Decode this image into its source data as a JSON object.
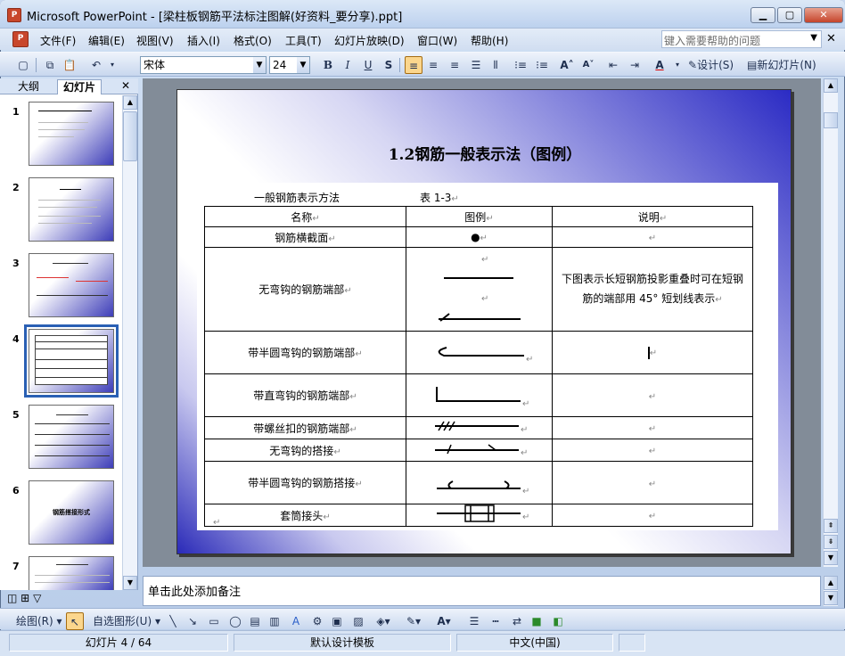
{
  "window": {
    "title": "Microsoft PowerPoint - [梁柱板钢筋平法标注图解(好资料_要分享).ppt]"
  },
  "menu": [
    "文件(F)",
    "编辑(E)",
    "视图(V)",
    "插入(I)",
    "格式(O)",
    "工具(T)",
    "幻灯片放映(D)",
    "窗口(W)",
    "帮助(H)"
  ],
  "help": {
    "placeholder": "键入需要帮助的问题"
  },
  "toolbar": {
    "font": "宋体",
    "size": "24",
    "design": "设计(S)",
    "new_slide": "新幻灯片(N)"
  },
  "panel": {
    "tabs": [
      "大纲",
      "幻灯片"
    ],
    "slide_numbers": [
      "1",
      "2",
      "3",
      "4",
      "5",
      "6",
      "7"
    ],
    "thumb6_text": "钢筋搭接形式"
  },
  "slide": {
    "title": "1.2钢筋一般表示法（图例）",
    "caption_left": "一般钢筋表示方法",
    "caption_right": "表 1-3",
    "headers": [
      "名称",
      "图例",
      "说明"
    ],
    "rows": [
      {
        "name": "钢筋横截面",
        "note": ""
      },
      {
        "name": "无弯钩的钢筋端部",
        "note": "下图表示长短钢筋投影重叠时可在短钢筋的端部用 45° 短划线表示"
      },
      {
        "name": "带半圆弯钩的钢筋端部",
        "note": ""
      },
      {
        "name": "带直弯钩的钢筋端部",
        "note": ""
      },
      {
        "name": "带螺丝扣的钢筋端部",
        "note": ""
      },
      {
        "name": "无弯钩的搭接",
        "note": ""
      },
      {
        "name": "带半圆弯钩的钢筋搭接",
        "note": ""
      },
      {
        "name": "套筒接头",
        "note": ""
      }
    ]
  },
  "notes": {
    "placeholder": "单击此处添加备注"
  },
  "draw": {
    "label": "绘图(R)",
    "autoshapes": "自选图形(U)"
  },
  "status": {
    "slide": "幻灯片 4 / 64",
    "template": "默认设计模板",
    "language": "中文(中国)"
  }
}
